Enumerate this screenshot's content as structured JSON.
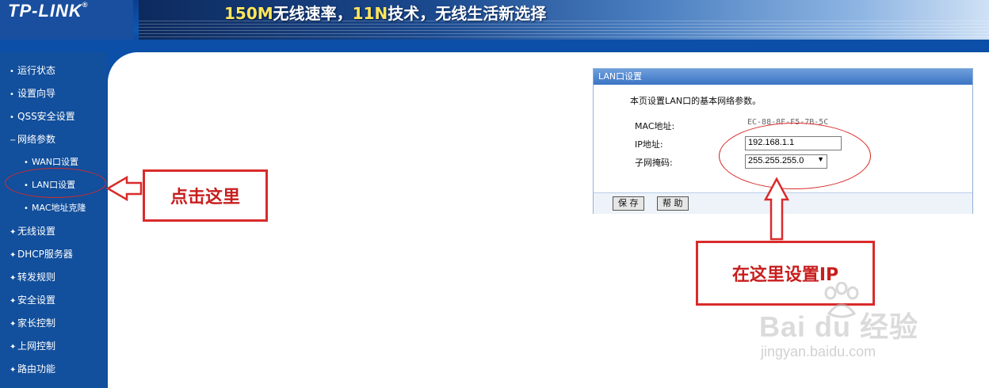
{
  "header": {
    "logo": "TP-LINK",
    "logo_mark": "®",
    "banner_part1": "150M",
    "banner_part2": "无线速率，",
    "banner_part3": "11N",
    "banner_part4": "技术，无线生活新选择"
  },
  "sidebar": {
    "items": [
      {
        "label": "运行状态",
        "bullet": "•"
      },
      {
        "label": "设置向导",
        "bullet": "•"
      },
      {
        "label": "QSS安全设置",
        "bullet": "•"
      },
      {
        "label": "网络参数",
        "bullet": "−"
      },
      {
        "label": "WAN口设置",
        "bullet": "•"
      },
      {
        "label": "LAN口设置",
        "bullet": "•"
      },
      {
        "label": "MAC地址克隆",
        "bullet": "•"
      },
      {
        "label": "无线设置",
        "bullet": "✦"
      },
      {
        "label": "DHCP服务器",
        "bullet": "✦"
      },
      {
        "label": "转发规则",
        "bullet": "✦"
      },
      {
        "label": "安全设置",
        "bullet": "✦"
      },
      {
        "label": "家长控制",
        "bullet": "✦"
      },
      {
        "label": "上网控制",
        "bullet": "✦"
      },
      {
        "label": "路由功能",
        "bullet": "✦"
      }
    ]
  },
  "panel": {
    "title": "LAN口设置",
    "description": "本页设置LAN口的基本网络参数。",
    "mac_label": "MAC地址:",
    "mac_value": "EC-88-8F-F5-7B-5C",
    "ip_label": "IP地址:",
    "ip_value": "192.168.1.1",
    "mask_label": "子网掩码:",
    "mask_value": "255.255.255.0",
    "save_label": "保 存",
    "help_label": "帮 助"
  },
  "annotations": {
    "click_here": "点击这里",
    "set_ip_here": "在这里设置IP",
    "accent": "#d92b2b"
  },
  "watermark": {
    "brand": "Bai du 经验",
    "url": "jingyan.baidu.com"
  }
}
